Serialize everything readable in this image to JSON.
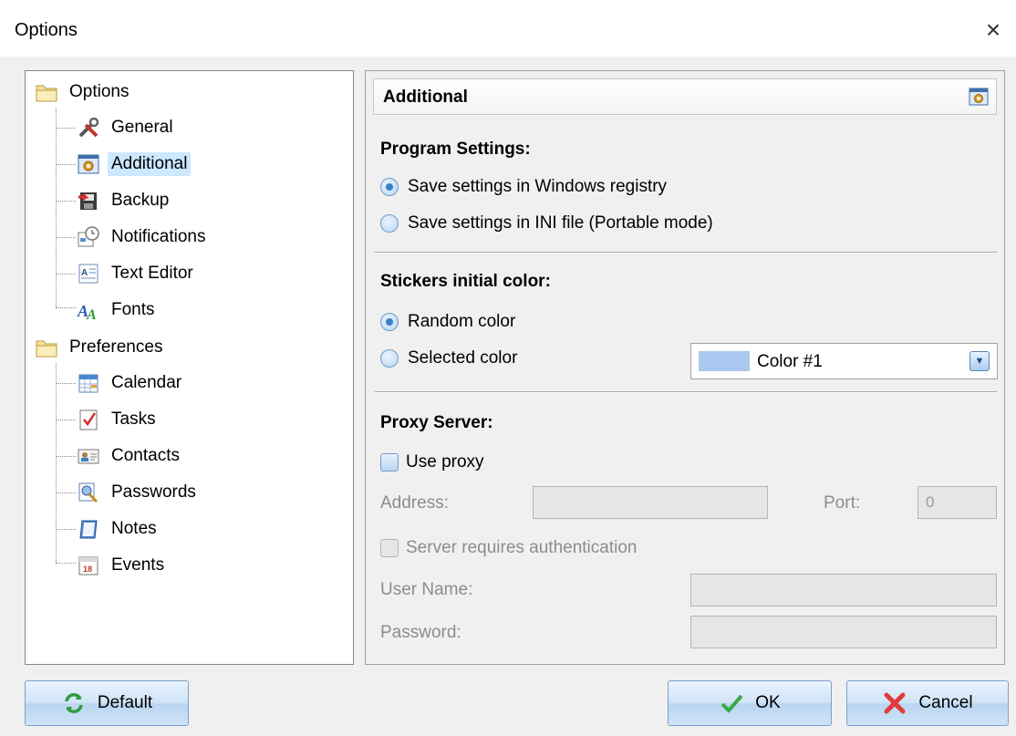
{
  "window": {
    "title": "Options",
    "close_glyph": "×"
  },
  "tree": [
    {
      "label": "Options",
      "icon": "folder-icon",
      "level": 0
    },
    {
      "label": "General",
      "icon": "tools-icon",
      "level": 1
    },
    {
      "label": "Additional",
      "icon": "settings-window-icon",
      "level": 1,
      "selected": true
    },
    {
      "label": "Backup",
      "icon": "backup-icon",
      "level": 1
    },
    {
      "label": "Notifications",
      "icon": "notification-clock-icon",
      "level": 1
    },
    {
      "label": "Text Editor",
      "icon": "text-document-icon",
      "level": 1
    },
    {
      "label": "Fonts",
      "icon": "fonts-icon",
      "level": 1
    },
    {
      "label": "Preferences",
      "icon": "folder-icon",
      "level": 0
    },
    {
      "label": "Calendar",
      "icon": "calendar-icon",
      "level": 1
    },
    {
      "label": "Tasks",
      "icon": "task-checklist-icon",
      "level": 1
    },
    {
      "label": "Contacts",
      "icon": "contact-card-icon",
      "level": 1
    },
    {
      "label": "Passwords",
      "icon": "password-key-icon",
      "level": 1
    },
    {
      "label": "Notes",
      "icon": "notepad-icon",
      "level": 1
    },
    {
      "label": "Events",
      "icon": "event-calendar-icon",
      "level": 1
    }
  ],
  "panel": {
    "header": "Additional",
    "program_settings": {
      "title": "Program Settings:",
      "option_registry": "Save settings in Windows registry",
      "option_ini": "Save settings in INI file (Portable mode)",
      "selected": "registry"
    },
    "stickers": {
      "title": "Stickers initial color:",
      "option_random": "Random color",
      "option_selected": "Selected color",
      "selected": "random",
      "color_value": "Color #1",
      "swatch_color": "#a9c8ef"
    },
    "proxy": {
      "title": "Proxy Server:",
      "use_proxy_label": "Use proxy",
      "use_proxy_checked": false,
      "address_label": "Address:",
      "address_value": "",
      "port_label": "Port:",
      "port_value": "0",
      "auth_label": "Server requires authentication",
      "username_label": "User Name:",
      "username_value": "",
      "password_label": "Password:",
      "password_value": ""
    }
  },
  "buttons": {
    "default": "Default",
    "ok": "OK",
    "cancel": "Cancel"
  },
  "colors": {
    "selection": "#cce8ff",
    "accent": "#3a7fc8",
    "disabled_text": "#8c8c8c"
  }
}
